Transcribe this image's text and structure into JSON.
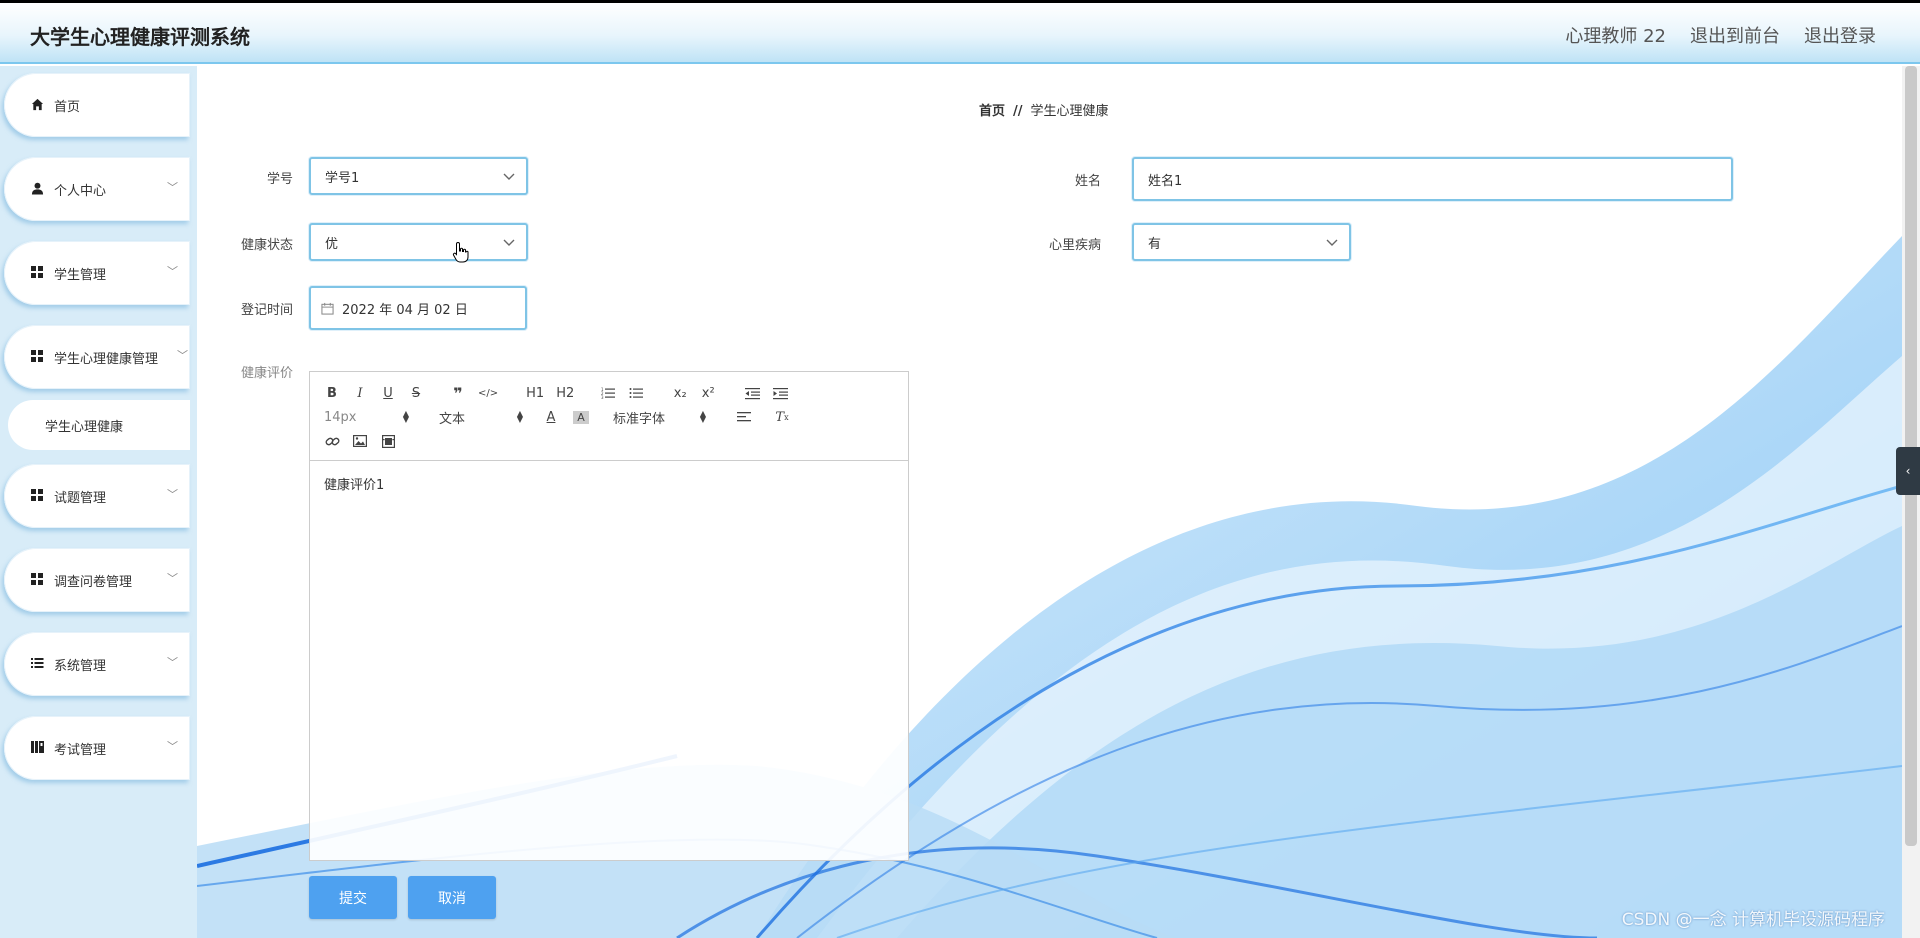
{
  "header": {
    "title": "大学生心理健康评测系统",
    "user": "心理教师 22",
    "front": "退出到前台",
    "logout": "退出登录"
  },
  "sidebar": {
    "items": [
      {
        "label": "首页",
        "icon": "home-icon"
      },
      {
        "label": "个人中心",
        "icon": "user-icon"
      },
      {
        "label": "学生管理",
        "icon": "grid-icon"
      },
      {
        "label": "学生心理健康管理",
        "icon": "grid-icon"
      },
      {
        "label": "试题管理",
        "icon": "grid-icon"
      },
      {
        "label": "调查问卷管理",
        "icon": "grid-icon"
      },
      {
        "label": "系统管理",
        "icon": "list-icon"
      },
      {
        "label": "考试管理",
        "icon": "book-icon"
      }
    ],
    "sub_item": "学生心理健康"
  },
  "breadcrumb": {
    "home": "首页",
    "sep": "//",
    "current": "学生心理健康"
  },
  "form": {
    "student_no_label": "学号",
    "student_no_value": "学号1",
    "name_label": "姓名",
    "name_value": "姓名1",
    "health_label": "健康状态",
    "health_value": "优",
    "disease_label": "心里疾病",
    "disease_value": "有",
    "date_label": "登记时间",
    "date_value": "2022 年 04 月 02 日",
    "evaluation_label": "健康评价"
  },
  "editor": {
    "font_size": "14px",
    "text_type": "文本",
    "font_family": "标准字体",
    "content": "健康评价1",
    "h1": "H1",
    "h2": "H2",
    "sub": "x₂",
    "sup": "x²"
  },
  "buttons": {
    "submit": "提交",
    "cancel": "取消"
  },
  "watermark": "CSDN @一念 计算机毕设源码程序",
  "colors": {
    "accent": "#4ea1f0",
    "border": "#7fc4e6",
    "sidebar_bg": "#d8ecf8"
  }
}
